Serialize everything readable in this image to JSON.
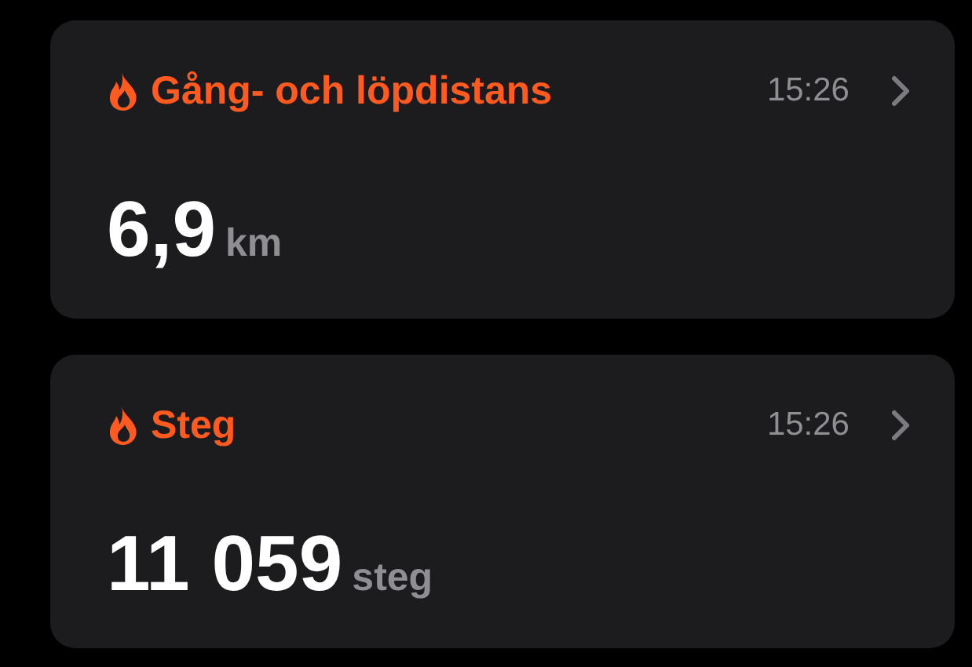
{
  "cards": [
    {
      "title": "Gång- och löpdistans",
      "time": "15:26",
      "value": "6,9",
      "unit": "km"
    },
    {
      "title": "Steg",
      "time": "15:26",
      "value": "11 059",
      "unit": "steg"
    }
  ]
}
